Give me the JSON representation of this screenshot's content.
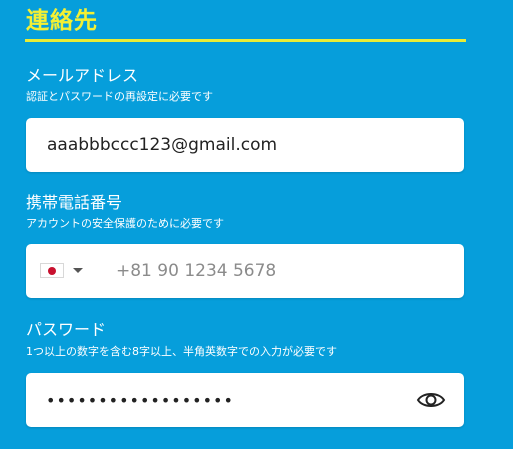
{
  "section": {
    "title": "連絡先"
  },
  "email": {
    "label": "メールアドレス",
    "hint": "認証とパスワードの再設定に必要です",
    "value": "aaabbbccc123@gmail.com"
  },
  "phone": {
    "label": "携帯電話番号",
    "hint": "アカウントの安全保護のために必要です",
    "country_flag": "japan-flag-icon",
    "placeholder": "+81 90 1234 5678"
  },
  "password": {
    "label": "パスワード",
    "hint": "1つ以上の数字を含む8字以上、半角英数字での入力が必要です",
    "masked_value": "••••••••••••••••••",
    "toggle_icon": "eye-icon"
  },
  "colors": {
    "background": "#069edb",
    "title_accent": "#f3f033",
    "flag_red": "#c8102e"
  }
}
